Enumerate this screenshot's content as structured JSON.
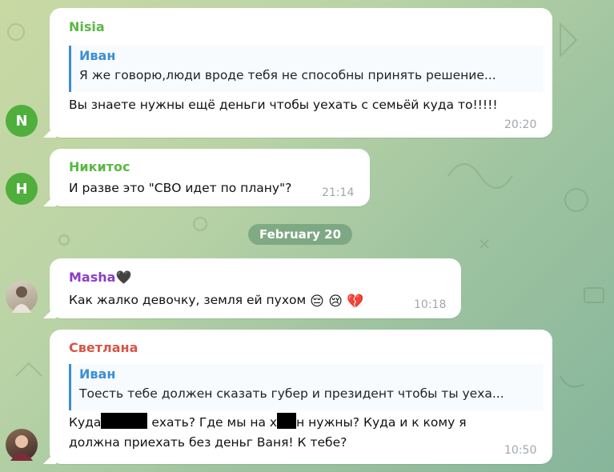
{
  "colors": {
    "nisia_name": "#5bb845",
    "nikitos_name": "#5bb845",
    "masha_name": "#8a3fc4",
    "svetlana_name": "#d65648",
    "quote_accent": "#3a8fd6",
    "avatar_green": "#4fae3c"
  },
  "date_separator": "February 20",
  "messages": [
    {
      "sender": "Nisia",
      "avatar_letter": "N",
      "quote": {
        "name": "Иван",
        "text": "Я же говорю,люди вроде тебя не способны принять решение..."
      },
      "text": "Вы знаете  нужны ещё деньги чтобы уехать с семьёй куда то!!!!!",
      "time": "20:20"
    },
    {
      "sender": "Никитос",
      "avatar_letter": "Н",
      "text": "И разве это \"СВО идет по плану\"?",
      "time": "21:14"
    },
    {
      "sender": "Masha",
      "sender_emoji": "🖤",
      "avatar": "photo-avatar",
      "text": "Как жалко девочку, земля ей пухом",
      "emojis": "😔 😢 💔",
      "time": "10:18"
    },
    {
      "sender": "Светлана",
      "avatar": "photo-avatar",
      "quote": {
        "name": "Иван",
        "text": "Тоесть тебе должен сказать губер и президент чтобы ты уеха..."
      },
      "line1_a": "Куда",
      "line1_b": "ехать?  Где мы на х",
      "line1_c": "н нужны? Куда и к кому я",
      "line2": "должна приехать без деньг Ваня! К тебе?",
      "time": "10:50"
    }
  ]
}
